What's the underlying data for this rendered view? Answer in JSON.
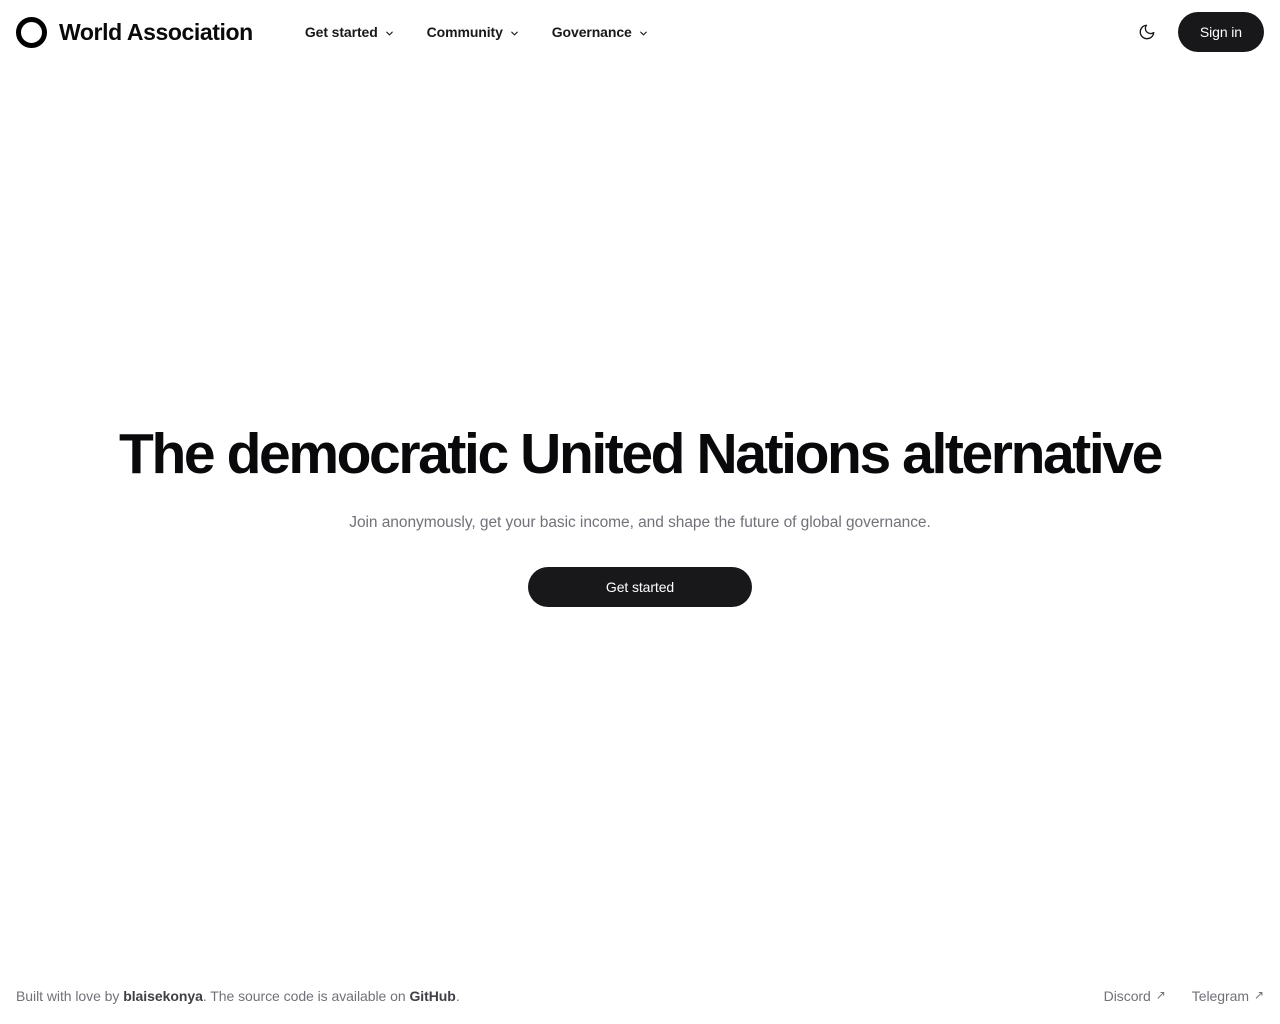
{
  "brand": {
    "name": "World Association",
    "logo_icon": "ring-circle-logo"
  },
  "nav": {
    "items": [
      {
        "label": "Get started",
        "icon": "chevron-down-icon"
      },
      {
        "label": "Community",
        "icon": "chevron-down-icon"
      },
      {
        "label": "Governance",
        "icon": "chevron-down-icon"
      }
    ]
  },
  "header_actions": {
    "theme_toggle_icon": "moon-icon",
    "sign_in_label": "Sign in"
  },
  "hero": {
    "title": "The democratic United Nations alternative",
    "subtitle": "Join anonymously, get your basic income, and shape the future of global governance.",
    "cta_label": "Get started"
  },
  "footer": {
    "credit_prefix": "Built with love by ",
    "credit_author": "blaisekonya",
    "credit_middle": ". The source code is available on ",
    "credit_repo": "GitHub",
    "credit_suffix": ".",
    "links": [
      {
        "label": "Discord",
        "icon": "external-link-arrow-icon",
        "arrow": "↗"
      },
      {
        "label": "Telegram",
        "icon": "external-link-arrow-icon",
        "arrow": "↗"
      }
    ]
  },
  "colors": {
    "background": "#ffffff",
    "text_primary": "#09090b",
    "text_muted": "#71717a",
    "button_bg": "#18181b",
    "button_text": "#ffffff"
  }
}
